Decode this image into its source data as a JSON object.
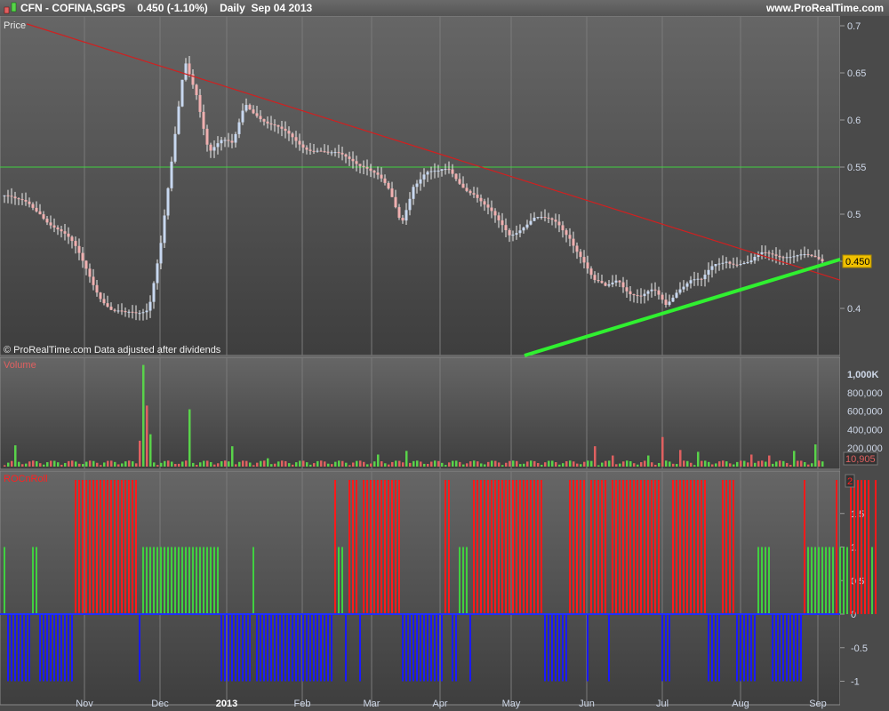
{
  "header": {
    "symbol": "CFN - COFINA,SGPS",
    "price": "0.450",
    "change": "(-1.10%)",
    "period": "Daily",
    "date": "Sep 04 2013",
    "site": "www.ProRealTime.com"
  },
  "colors": {
    "up": "#59d34a",
    "down": "#e06060",
    "candle_up": "#c8d8f0",
    "candle_down": "#f0b0b0",
    "trend_red": "#d02020",
    "support_green": "#30f030",
    "hline": "#40d040",
    "roc_red": "#ff1a1a",
    "roc_green": "#40d040",
    "roc_blue": "#1a1aff"
  },
  "chart_data": [
    {
      "type": "line",
      "title": "Price",
      "note": "© ProRealTime.com  Data adjusted after dividends",
      "ylim": [
        0.36,
        0.71
      ],
      "yticks": [
        "0.7",
        "0.65",
        "0.6",
        "0.55",
        "0.5",
        "0.45",
        "0.4"
      ],
      "last_value": "0.450",
      "horizontal_line": 0.55,
      "x_labels": [
        "Nov",
        "Dec",
        "2013",
        "Feb",
        "Mar",
        "Apr",
        "May",
        "Jun",
        "Jul",
        "Aug",
        "Sep"
      ],
      "closes_sampled": [
        0.52,
        0.51,
        0.51,
        0.505,
        0.49,
        0.475,
        0.46,
        0.44,
        0.415,
        0.395,
        0.39,
        0.395,
        0.405,
        0.47,
        0.56,
        0.66,
        0.63,
        0.57,
        0.575,
        0.57,
        0.62,
        0.61,
        0.595,
        0.585,
        0.58,
        0.575,
        0.57,
        0.56,
        0.56,
        0.56,
        0.555,
        0.54,
        0.52,
        0.49,
        0.535,
        0.545,
        0.54,
        0.545,
        0.535,
        0.525,
        0.505,
        0.49,
        0.48,
        0.49,
        0.495,
        0.49,
        0.49,
        0.48,
        0.455,
        0.425,
        0.42,
        0.435,
        0.42,
        0.41,
        0.415,
        0.405,
        0.425,
        0.43,
        0.425,
        0.445,
        0.455,
        0.45,
        0.445,
        0.455,
        0.46,
        0.46,
        0.455,
        0.45,
        0.45
      ]
    },
    {
      "type": "bar",
      "title": "Volume",
      "yticks": [
        "1,000K",
        "800,000",
        "600,000",
        "400,000",
        "200,000"
      ],
      "ylim": [
        0,
        1100000
      ],
      "last_value": "10,905",
      "volume_spikes_k": [
        [
          3,
          230
        ],
        [
          38,
          280
        ],
        [
          39,
          1100
        ],
        [
          40,
          660
        ],
        [
          41,
          350
        ],
        [
          52,
          620
        ],
        [
          64,
          220
        ],
        [
          74,
          90
        ],
        [
          105,
          130
        ],
        [
          113,
          170
        ],
        [
          144,
          60
        ],
        [
          166,
          220
        ],
        [
          171,
          120
        ],
        [
          181,
          120
        ],
        [
          185,
          320
        ],
        [
          190,
          180
        ],
        [
          195,
          160
        ],
        [
          210,
          130
        ],
        [
          215,
          120
        ],
        [
          222,
          170
        ],
        [
          228,
          240
        ],
        [
          231,
          100
        ]
      ]
    },
    {
      "type": "bar",
      "title": "ROCnRoll",
      "yticks": [
        "1.5",
        "1",
        "0.5",
        "0",
        "-0.5",
        "-1"
      ],
      "ylim": [
        -1.05,
        2
      ],
      "last_value": "2",
      "runs": [
        [
          1,
          1
        ],
        [
          -1,
          7
        ],
        [
          1,
          2
        ],
        [
          -1,
          10
        ],
        [
          2,
          18
        ],
        [
          -1,
          1
        ],
        [
          1,
          22
        ],
        [
          -1,
          9
        ],
        [
          1,
          1
        ],
        [
          -1,
          22
        ],
        [
          2,
          1
        ],
        [
          1,
          2
        ],
        [
          -1,
          1
        ],
        [
          2,
          3
        ],
        [
          -1,
          1
        ],
        [
          2,
          11
        ],
        [
          -1,
          12
        ],
        [
          2,
          2
        ],
        [
          -1,
          2
        ],
        [
          1,
          3
        ],
        [
          -1,
          1
        ],
        [
          2,
          20
        ],
        [
          -1,
          7
        ],
        [
          2,
          5
        ],
        [
          -1,
          1
        ],
        [
          2,
          5
        ],
        [
          -1,
          1
        ],
        [
          2,
          14
        ],
        [
          -1,
          3
        ],
        [
          2,
          10
        ],
        [
          -1,
          4
        ],
        [
          2,
          4
        ],
        [
          -1,
          6
        ],
        [
          1,
          4
        ],
        [
          -1,
          9
        ],
        [
          2,
          1
        ],
        [
          1,
          8
        ],
        [
          2,
          1
        ],
        [
          1,
          3
        ],
        [
          2,
          6
        ],
        [
          1,
          1
        ],
        [
          2,
          1
        ]
      ]
    }
  ]
}
